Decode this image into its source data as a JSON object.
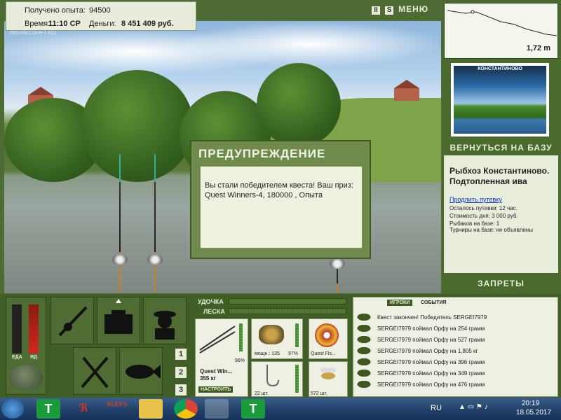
{
  "hud": {
    "exp_label": "Получено опыта:",
    "exp_value": "94500",
    "time_label": "Время:",
    "time_value": "11:10 СР",
    "money_label": "Деньги:",
    "money_value": "8 451 409 руб."
  },
  "watermark": "INSTALLSOFT.RU",
  "topbar": {
    "pause": "II",
    "s": "S",
    "menu": "МЕНЮ"
  },
  "depth": {
    "value": "1,72 m"
  },
  "location_image": {
    "title": "КОНСТАНТИНОВО"
  },
  "return_base": "ВЕРНУТЬСЯ НА БАЗУ",
  "info": {
    "title": "Рыбхоз Константиново. Подтопленная ива",
    "extend": "Продлить путевку",
    "left": "Осталось путевки: 12 час.",
    "cost": "Стоимость дня: 3 000 руб.",
    "fishers": "Рыбаков на базе: 1",
    "tournaments": "Турниры на базе: не объявлены"
  },
  "bans": "ЗАПРЕТЫ",
  "dialog": {
    "title": "ПРЕДУПРЕЖДЕНИЕ",
    "message": "Вы стали победителем квеста! Ваш приз: Quest Winners-4, 180000 , Опыта"
  },
  "stats": {
    "food": "ЕДА",
    "yad": "ЯД"
  },
  "gauges": {
    "rod": "УДОЧКА",
    "line": "ЛЕСКА"
  },
  "tackle": {
    "rod_name": "Quest Win...",
    "rod_weight": "355 кг",
    "rod_pct": "96%",
    "setup": "НАСТРОИТЬ",
    "reel_power": "мощн.: 135",
    "reel_pct": "97%",
    "line_name": "Quest Fis...",
    "hooks": "22 шт.",
    "bait": "572 шт."
  },
  "numbers": [
    "1",
    "2",
    "3"
  ],
  "log": {
    "tab_players": "ИГРОКИ",
    "tab_events": "СОБЫТИЯ",
    "entries": [
      "Квест закончен! Победитель SERGEI7979",
      "SERGEI7979 поймал Орфу на 254 грамм",
      "SERGEI7979 поймал Орфу на 527 грамм",
      "SERGEI7979 поймал Орфу на 1,805 кг",
      "SERGEI7979 поймал Орфу на 396 грамм",
      "SERGEI7979 поймал Орфу на 349 грамм",
      "SERGEI7979 поймал Орфу на 476 грамм"
    ]
  },
  "taskbar": {
    "lang": "RU",
    "time": "20:19",
    "date": "18.05.2017",
    "klev": "KLEV 5",
    "t1": "T",
    "t2": "T"
  }
}
